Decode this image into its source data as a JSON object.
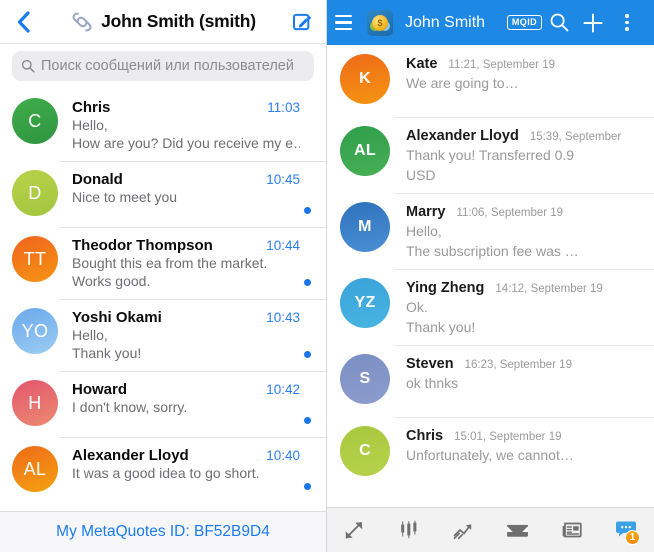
{
  "ios": {
    "header": {
      "back_icon": "chevron-left-icon",
      "logo_icon": "metaquotes-logo-icon",
      "title": "John Smith (smith)",
      "compose_icon": "compose-pencil-icon"
    },
    "search": {
      "icon": "search-icon",
      "placeholder": "Поиск сообщений или пользователей",
      "value": ""
    },
    "chats": [
      {
        "initials": "C",
        "name": "Chris",
        "time": "11:03",
        "preview_line1": "Hello,",
        "preview_line2": "How are you? Did you receive my e…",
        "unread": false,
        "color_start": "#3fae4a",
        "color_end": "#2f9440"
      },
      {
        "initials": "D",
        "name": "Donald",
        "time": "10:45",
        "preview_line1": "Nice to meet you",
        "preview_line2": "",
        "unread": true,
        "color_start": "#b7d24a",
        "color_end": "#a3c63f"
      },
      {
        "initials": "TT",
        "name": "Theodor Thompson",
        "time": "10:44",
        "preview_line1": "Bought this ea from the market.",
        "preview_line2": "Works good.",
        "unread": true,
        "color_start": "#f0641e",
        "color_end": "#f59412"
      },
      {
        "initials": "YO",
        "name": "Yoshi Okami",
        "time": "10:43",
        "preview_line1": "Hello,",
        "preview_line2": "Thank you!",
        "unread": true,
        "color_start": "#6aa8ec",
        "color_end": "#9ccdf2"
      },
      {
        "initials": "H",
        "name": "Howard",
        "time": "10:42",
        "preview_line1": "I don't know, sorry.",
        "preview_line2": "",
        "unread": true,
        "color_start": "#e2566c",
        "color_end": "#ed8a72"
      },
      {
        "initials": "AL",
        "name": "Alexander Lloyd",
        "time": "10:40",
        "preview_line1": "It was a good idea to go short.",
        "preview_line2": "",
        "unread": true,
        "color_start": "#ef6a18",
        "color_end": "#f5a211"
      }
    ],
    "footer": {
      "label": "My MetaQuotes ID: BF52B9D4",
      "color": "#1a7cf0"
    }
  },
  "android": {
    "header": {
      "menu_icon": "hamburger-menu-icon",
      "app_icon": "metatrader-app-icon",
      "app_icon_symbol": "$",
      "title": "John Smith",
      "mqid_badge": "MQID",
      "search_icon": "search-icon",
      "add_icon": "plus-icon",
      "overflow_icon": "kebab-menu-icon",
      "bg_color": "#1e88e5"
    },
    "chats": [
      {
        "initials": "K",
        "name": "Kate",
        "time": "11:21, September 19",
        "preview_line1": "We are going to…",
        "preview_line2": "",
        "color_start": "#ef6a18",
        "color_end": "#f59512"
      },
      {
        "initials": "AL",
        "name": "Alexander Lloyd",
        "time": "15:39, September",
        "preview_line1": "Thank you! Transferred 0.9",
        "preview_line2": "USD",
        "color_start": "#2f9e4a",
        "color_end": "#47b055"
      },
      {
        "initials": "M",
        "name": "Marry",
        "time": "11:06, September 19",
        "preview_line1": "Hello,",
        "preview_line2": "The subscription fee was …",
        "color_start": "#2f72bd",
        "color_end": "#4a8fd4"
      },
      {
        "initials": "YZ",
        "name": "Ying Zheng",
        "time": "14:12, September 19",
        "preview_line1": "Ok.",
        "preview_line2": "Thank you!",
        "color_start": "#3aa2d9",
        "color_end": "#48b5e2"
      },
      {
        "initials": "S",
        "name": "Steven",
        "time": "16:23, September 19",
        "preview_line1": "ok thnks",
        "preview_line2": "",
        "color_start": "#7b8fc4",
        "color_end": "#8c9dcc"
      },
      {
        "initials": "C",
        "name": "Chris",
        "time": "15:01, September 19",
        "preview_line1": "Unfortunately, we cannot…",
        "preview_line2": "",
        "color_start": "#a8c83e",
        "color_end": "#b6d24c"
      }
    ],
    "tabs": [
      {
        "icon": "quotes-arrows-icon",
        "label": "Quotes"
      },
      {
        "icon": "candlestick-chart-icon",
        "label": "Charts"
      },
      {
        "icon": "trade-trend-icon",
        "label": "Trade"
      },
      {
        "icon": "mailbox-inbox-icon",
        "label": "Mailbox"
      },
      {
        "icon": "news-paper-icon",
        "label": "News"
      },
      {
        "icon": "chat-bubble-icon",
        "label": "Chat",
        "badge": "1"
      }
    ]
  }
}
